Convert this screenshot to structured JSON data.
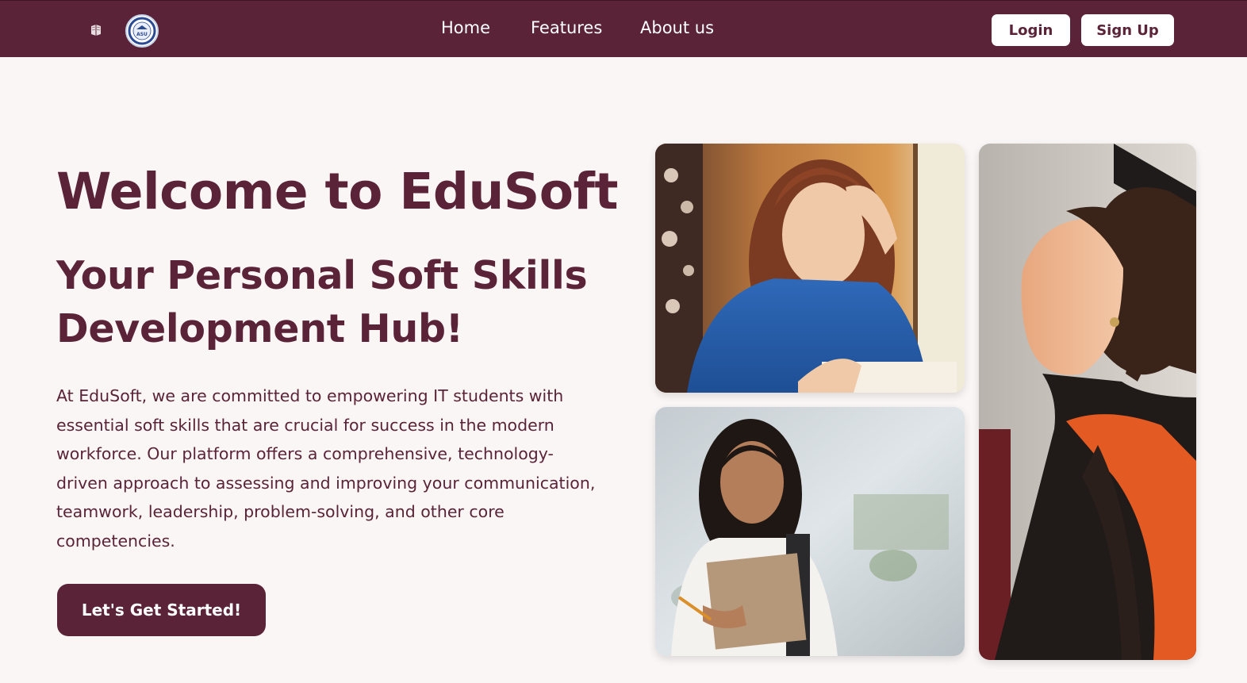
{
  "nav": {
    "links": [
      "Home",
      "Features",
      "About us"
    ],
    "login_label": "Login",
    "signup_label": "Sign Up",
    "seal_text": "ASU"
  },
  "hero": {
    "title": "Welcome to EduSoft",
    "subtitle": "Your Personal Soft Skills Development Hub!",
    "description": "At EduSoft, we are committed to empowering IT students with essential soft skills that are crucial for success in the modern workforce. Our platform offers a comprehensive, technology-driven approach to assessing and improving your communication, teamwork, leadership, problem-solving, and other core competencies.",
    "cta_label": "Let's Get Started!"
  },
  "gallery": {
    "photos": [
      "student-studying-photo",
      "student-with-folder-photo",
      "graduate-photo"
    ]
  },
  "colors": {
    "brand": "#5a2338",
    "background": "#faf6f6",
    "button_bg": "#ffffff"
  }
}
